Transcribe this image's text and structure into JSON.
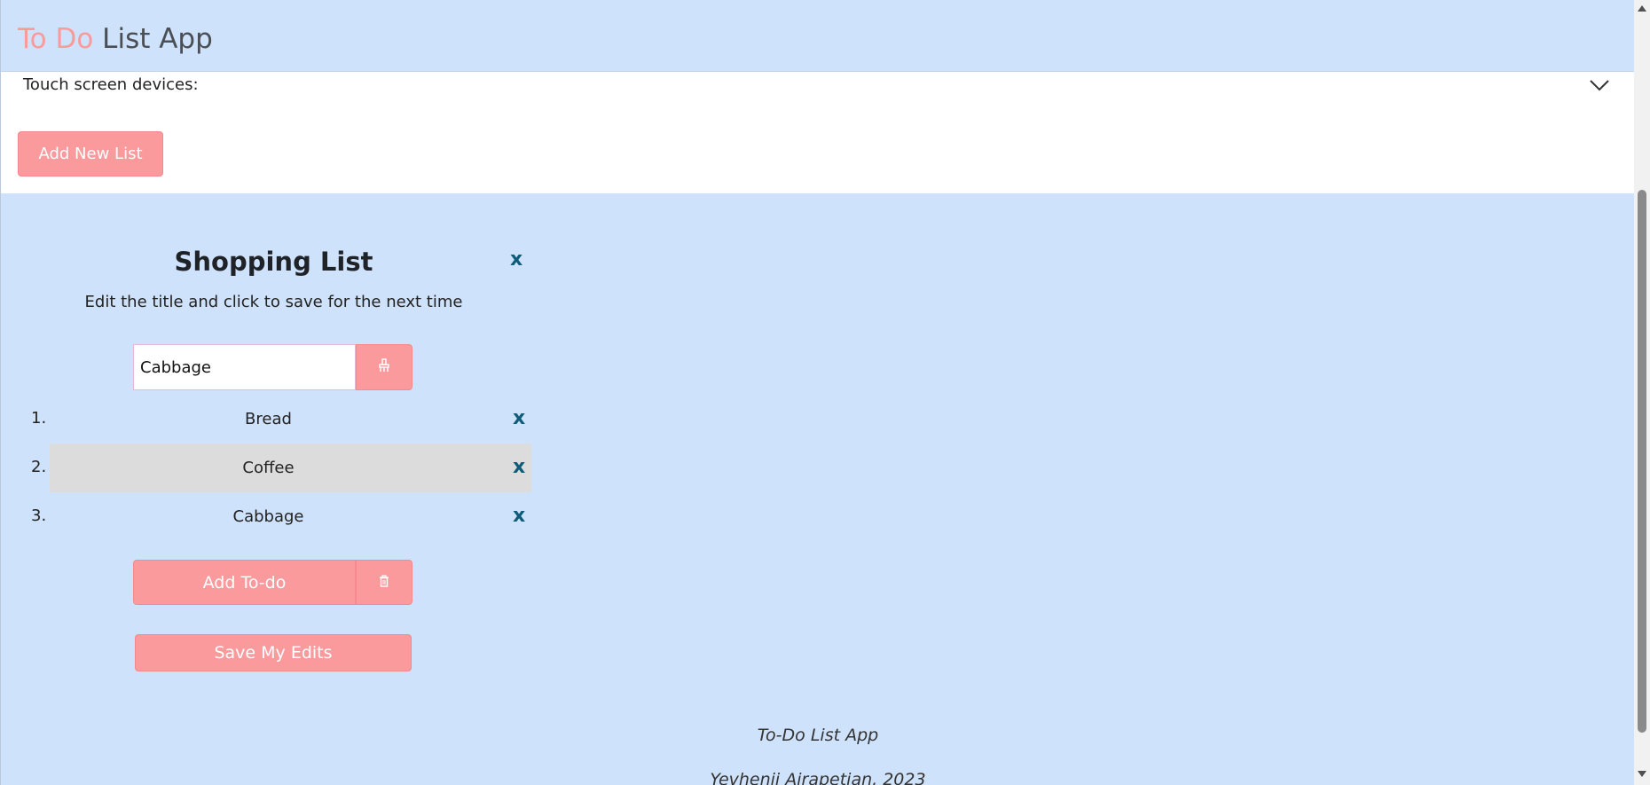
{
  "header": {
    "title_accent": "To Do",
    "title_rest": " List App"
  },
  "info": {
    "touch_label": "Touch screen devices:",
    "toggle_icon": "chevron-down-icon"
  },
  "toolbar": {
    "add_new_list_label": "Add New List"
  },
  "list": {
    "title": "Shopping List",
    "close_label": "x",
    "subtitle": "Edit the title and click to save for the next time",
    "input_value": "Cabbage",
    "clear_icon": "broom-icon",
    "items": [
      {
        "number": "1.",
        "text": "Bread",
        "remove_label": "x"
      },
      {
        "number": "2.",
        "text": "Coffee",
        "remove_label": "x"
      },
      {
        "number": "3.",
        "text": "Cabbage",
        "remove_label": "x"
      }
    ],
    "add_todo_label": "Add To-do",
    "delete_icon": "trash-icon",
    "save_edits_label": "Save My Edits"
  },
  "footer": {
    "app_name": "To-Do List App",
    "author": "Yevhenii Airapetian, 2023"
  },
  "colors": {
    "background": "#cfe2fb",
    "accent": "#fa9a9c",
    "remove_x": "#0d5d7a",
    "highlight_row": "#dcdcdc"
  }
}
